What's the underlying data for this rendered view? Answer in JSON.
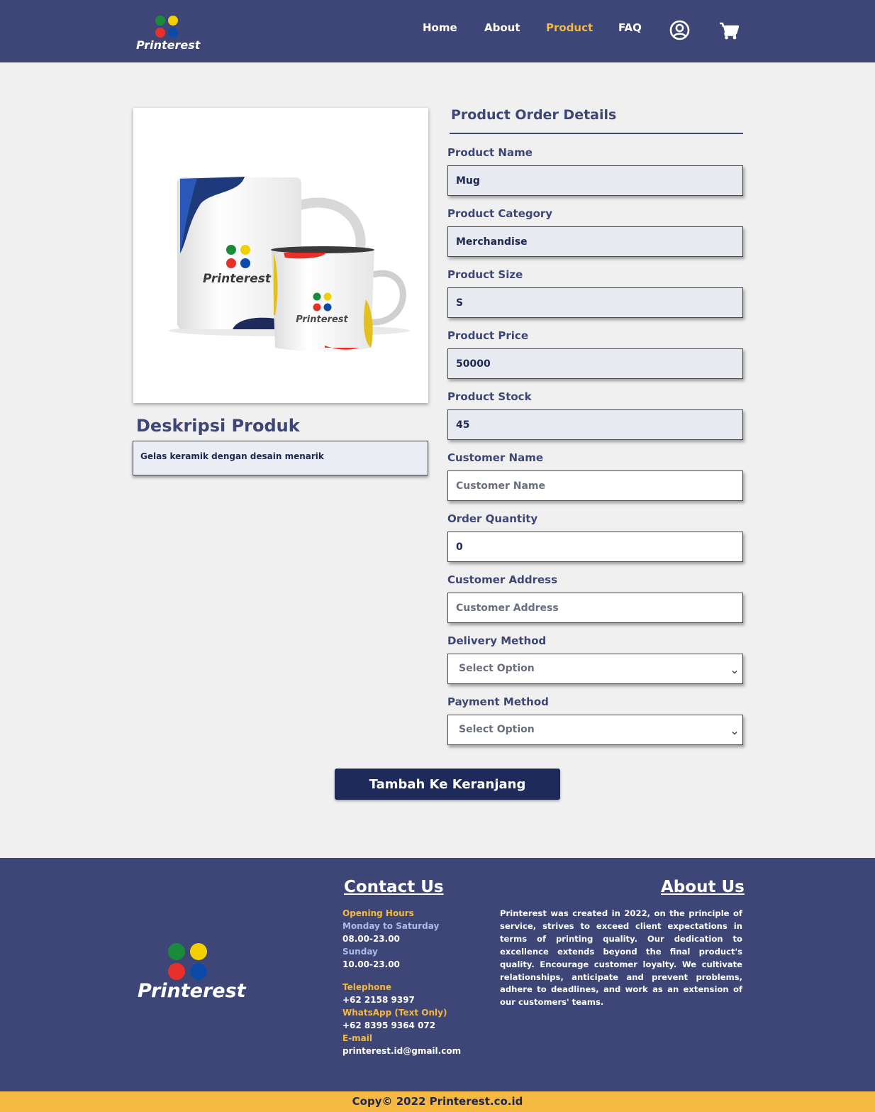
{
  "brand": {
    "name": "Printerest",
    "colors": {
      "green": "#1a8b3a",
      "yellow": "#f2d000",
      "red": "#e8302b",
      "blue": "#0b4aa8"
    }
  },
  "nav": {
    "items": [
      {
        "label": "Home",
        "active": false
      },
      {
        "label": "About",
        "active": false
      },
      {
        "label": "Product",
        "active": true
      },
      {
        "label": "FAQ",
        "active": false
      }
    ],
    "icons": [
      "user-circle-icon",
      "shopping-cart-icon"
    ]
  },
  "product": {
    "image_icon": "mug-product-image",
    "mug_brand_text": "Printerest",
    "description_title": "Deskripsi Produk",
    "description": "Gelas keramik dengan desain menarik"
  },
  "form": {
    "title": "Product Order Details",
    "product_name": {
      "label": "Product Name",
      "value": "Mug"
    },
    "product_category": {
      "label": "Product Category",
      "value": "Merchandise"
    },
    "product_size": {
      "label": "Product Size",
      "value": "S"
    },
    "product_price": {
      "label": "Product Price",
      "value": "50000"
    },
    "product_stock": {
      "label": "Product Stock",
      "value": "45"
    },
    "customer_name": {
      "label": "Customer Name",
      "placeholder": "Customer Name",
      "value": ""
    },
    "order_quantity": {
      "label": "Order Quantity",
      "value": "0"
    },
    "customer_address": {
      "label": "Customer Address",
      "placeholder": "Customer Address",
      "value": ""
    },
    "delivery_method": {
      "label": "Delivery Method",
      "selected": "Select Option"
    },
    "payment_method": {
      "label": "Payment Method",
      "selected": "Select Option"
    },
    "submit_label": "Tambah Ke Keranjang"
  },
  "footer": {
    "contact": {
      "heading": "Contact Us",
      "opening_hours_label": "Opening Hours",
      "weekday_label": "Monday to Saturday",
      "weekday_hours": "08.00-23.00",
      "sunday_label": "Sunday",
      "sunday_hours": "10.00-23.00",
      "telephone_label": "Telephone",
      "telephone": "+62 2158 9397",
      "whatsapp_label": "WhatsApp (Text Only)",
      "whatsapp": "+62 8395 9364 072",
      "email_label": "E-mail",
      "email": "printerest.id@gmail.com"
    },
    "about": {
      "heading": "About Us",
      "text": "Printerest was created in 2022, on the principle of service, strives to exceed client expectations in terms of printing quality. Our dedication to excellence extends beyond the final product's quality. Encourage customer loyalty. We cultivate relationships, anticipate and prevent problems, adhere to deadlines, and work as an extension of our customers' teams."
    },
    "copyright": "Copy© 2022 Printerest.co.id"
  },
  "colors": {
    "navy": "#3d4676",
    "accent": "#f5b942",
    "button": "#1e2a5a"
  }
}
